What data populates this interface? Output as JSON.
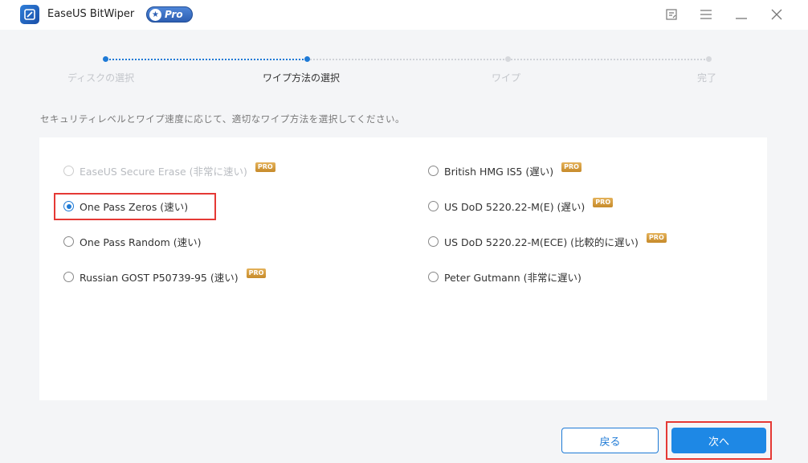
{
  "app": {
    "title": "EaseUS BitWiper",
    "pro_label": "Pro"
  },
  "steps": [
    {
      "label": "ディスクの選択",
      "state": "done"
    },
    {
      "label": "ワイプ方法の選択",
      "state": "active"
    },
    {
      "label": "ワイプ",
      "state": "pending"
    },
    {
      "label": "完了",
      "state": "pending"
    }
  ],
  "instruction": "セキュリティレベルとワイプ速度に応じて、適切なワイプ方法を選択してください。",
  "methods_left": [
    {
      "label": "EaseUS Secure Erase (非常に速い)",
      "pro": true,
      "disabled": true,
      "selected": false
    },
    {
      "label": "One Pass Zeros (速い)",
      "pro": false,
      "disabled": false,
      "selected": true
    },
    {
      "label": "One Pass Random (速い)",
      "pro": false,
      "disabled": false,
      "selected": false
    },
    {
      "label": "Russian GOST P50739-95 (速い)",
      "pro": true,
      "disabled": false,
      "selected": false
    }
  ],
  "methods_right": [
    {
      "label": "British HMG IS5 (遅い)",
      "pro": true,
      "disabled": false,
      "selected": false
    },
    {
      "label": "US DoD 5220.22-M(E) (遅い)",
      "pro": true,
      "disabled": false,
      "selected": false
    },
    {
      "label": "US DoD 5220.22-M(ECE) (比較的に遅い)",
      "pro": true,
      "disabled": false,
      "selected": false
    },
    {
      "label": "Peter Gutmann (非常に遅い)",
      "pro": false,
      "disabled": false,
      "selected": false
    }
  ],
  "pro_tag": "PRO",
  "buttons": {
    "back": "戻る",
    "next": "次へ"
  },
  "colors": {
    "accent": "#1e7ad6",
    "highlight": "#e53935",
    "pro_tag": "#c68a2a"
  }
}
